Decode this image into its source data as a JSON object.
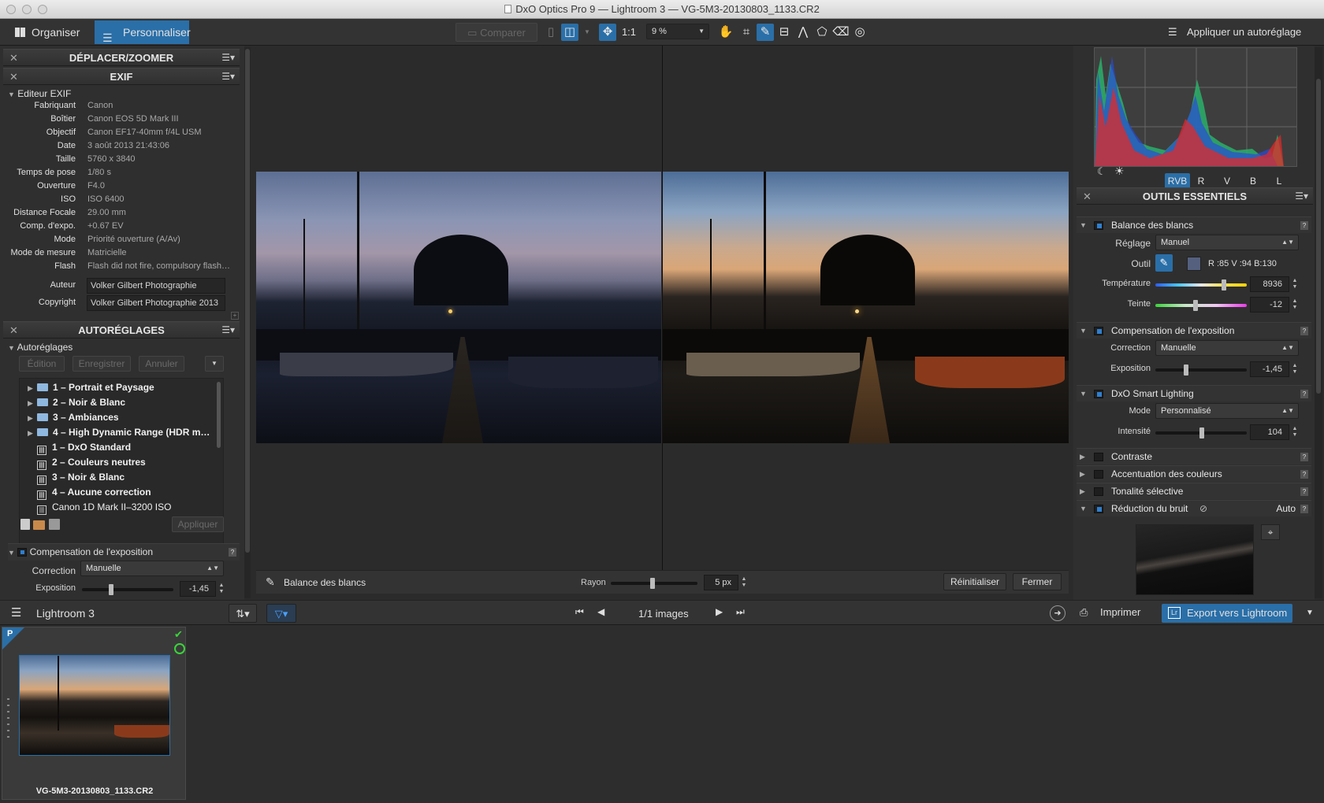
{
  "window": {
    "title": "DxO Optics Pro 9 — Lightroom 3 — VG-5M3-20130803_1133.CR2"
  },
  "toolbar": {
    "tab_organize": "Organiser",
    "tab_customize": "Personnaliser",
    "compare": "Comparer",
    "one_to_one": "1:1",
    "zoom": "9 %",
    "apply_preset": "Appliquer un autoréglage"
  },
  "left": {
    "move_zoom_title": "DÉPLACER/ZOOMER",
    "exif_title": "EXIF",
    "exif_editor": "Editeur EXIF",
    "exif": [
      {
        "k": "Fabriquant",
        "v": "Canon"
      },
      {
        "k": "Boîtier",
        "v": "Canon EOS 5D Mark III"
      },
      {
        "k": "Objectif",
        "v": "Canon EF17-40mm f/4L USM"
      },
      {
        "k": "Date",
        "v": "3 août 2013 21:43:06"
      },
      {
        "k": "Taille",
        "v": "5760 x 3840"
      },
      {
        "k": "Temps de pose",
        "v": "1/80 s"
      },
      {
        "k": "Ouverture",
        "v": "F4.0"
      },
      {
        "k": "ISO",
        "v": "ISO 6400"
      },
      {
        "k": "Distance Focale",
        "v": "29.00 mm"
      },
      {
        "k": "Comp. d'expo.",
        "v": "+0.67 EV"
      },
      {
        "k": "Mode",
        "v": "Priorité ouverture (A/Av)"
      },
      {
        "k": "Mode de mesure",
        "v": "Matricielle"
      },
      {
        "k": "Flash",
        "v": "Flash did not fire, compulsory flash…"
      }
    ],
    "author_label": "Auteur",
    "author": "Volker Gilbert Photographie",
    "copyright_label": "Copyright",
    "copyright": "Volker Gilbert Photographie 2013",
    "presets_title": "AUTORÉGLAGES",
    "presets_sub": "Autoréglages",
    "btn_edit": "Édition",
    "btn_save": "Enregistrer",
    "btn_cancel": "Annuler",
    "tree": [
      {
        "label": "1 – Portrait et Paysage",
        "kind": "folder"
      },
      {
        "label": "2 – Noir & Blanc",
        "kind": "folder"
      },
      {
        "label": "3 – Ambiances",
        "kind": "folder"
      },
      {
        "label": "4 – High Dynamic Range (HDR m…",
        "kind": "folder"
      },
      {
        "label": "1 – DxO Standard",
        "kind": "preset"
      },
      {
        "label": "2 – Couleurs neutres",
        "kind": "preset"
      },
      {
        "label": "3 – Noir & Blanc",
        "kind": "preset"
      },
      {
        "label": "4 – Aucune correction",
        "kind": "preset"
      },
      {
        "label": "Canon 1D Mark II–3200 ISO",
        "kind": "preset"
      }
    ],
    "btn_apply": "Appliquer",
    "expo_title": "Compensation de l'exposition",
    "expo_correction_label": "Correction",
    "expo_correction": "Manuelle",
    "expo_label": "Exposition",
    "expo_value": "-1,45"
  },
  "viewer": {
    "tool_name": "Balance des blancs",
    "radius_label": "Rayon",
    "radius_value": "5 px",
    "reset": "Réinitialiser",
    "close": "Fermer"
  },
  "right": {
    "hist_channels": [
      "RVB",
      "R",
      "V",
      "B",
      "L"
    ],
    "essentials_title": "OUTILS ESSENTIELS",
    "wb_title": "Balance des blancs",
    "wb_setting_label": "Réglage",
    "wb_setting": "Manuel",
    "wb_tool_label": "Outil",
    "wb_rgb": "R :85 V :94 B:130",
    "temp_label": "Température",
    "temp_value": "8936",
    "tint_label": "Teinte",
    "tint_value": "-12",
    "ec_title": "Compensation de l'exposition",
    "ec_correction_label": "Correction",
    "ec_correction": "Manuelle",
    "ec_expo_label": "Exposition",
    "ec_expo_value": "-1,45",
    "sl_title": "DxO Smart Lighting",
    "sl_mode_label": "Mode",
    "sl_mode": "Personnalisé",
    "sl_intensity_label": "Intensité",
    "sl_intensity": "104",
    "contrast": "Contraste",
    "color_accent": "Accentuation des couleurs",
    "selective_tone": "Tonalité sélective",
    "noise_title": "Réduction du bruit",
    "noise_auto": "Auto"
  },
  "filmbar": {
    "project": "Lightroom 3",
    "counter": "1/1 images",
    "print": "Imprimer",
    "export": "Export vers Lightroom"
  },
  "film": {
    "filename": "VG-5M3-20130803_1133.CR2",
    "badge": "P"
  },
  "colors": {
    "accent": "#2a6fa8",
    "panel": "#2f2f2f"
  }
}
